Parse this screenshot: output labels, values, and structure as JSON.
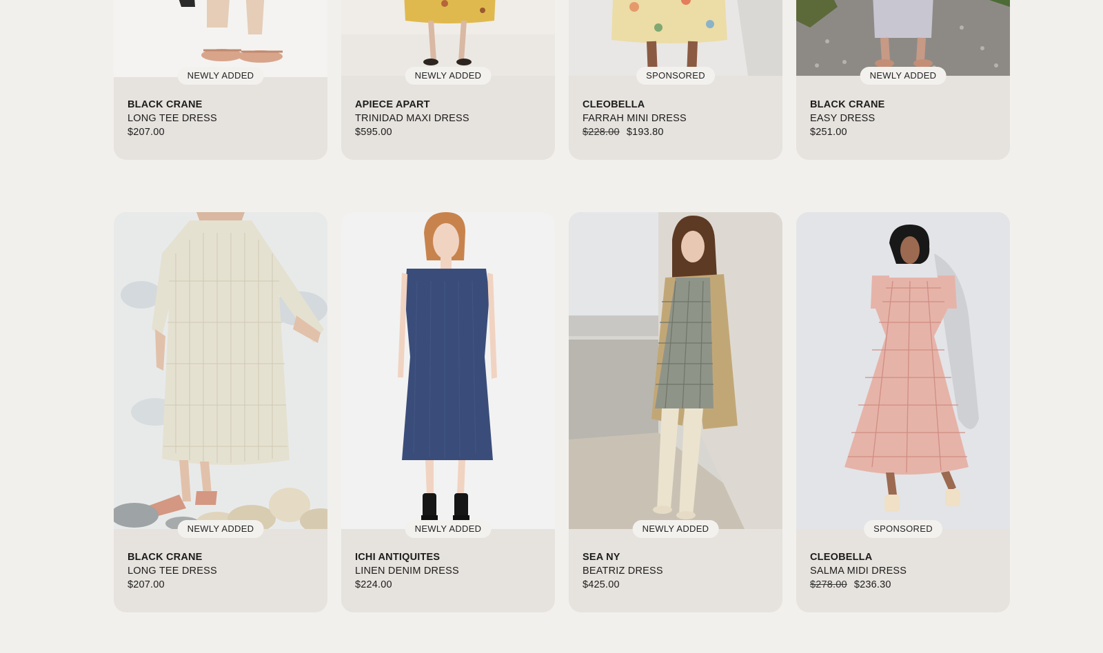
{
  "products": [
    {
      "badge": "NEWLY ADDED",
      "brand": "BLACK CRANE",
      "name": "LONG TEE DRESS",
      "price": "$207.00",
      "image": "model-woven-sandals-photo"
    },
    {
      "badge": "NEWLY ADDED",
      "brand": "APIECE APART",
      "name": "TRINIDAD MAXI DRESS",
      "price": "$595.00",
      "image": "model-yellow-floral-dress-photo"
    },
    {
      "badge": "SPONSORED",
      "brand": "CLEOBELLA",
      "name": "FARRAH MINI DRESS",
      "original_price": "$228.00",
      "sale_price": "$193.80",
      "image": "model-floral-mini-dress-photo"
    },
    {
      "badge": "NEWLY ADDED",
      "brand": "BLACK CRANE",
      "name": "EASY DRESS",
      "price": "$251.00",
      "image": "model-gravel-garden-photo"
    },
    {
      "badge": "NEWLY ADDED",
      "brand": "BLACK CRANE",
      "name": "LONG TEE DRESS",
      "price": "$207.00",
      "image": "model-cream-knit-dress-photo"
    },
    {
      "badge": "NEWLY ADDED",
      "brand": "ICHI ANTIQUITES",
      "name": "LINEN DENIM DRESS",
      "price": "$224.00",
      "image": "model-navy-linen-dress-photo"
    },
    {
      "badge": "NEWLY ADDED",
      "brand": "SEA NY",
      "name": "BEATRIZ DRESS",
      "price": "$425.00",
      "image": "model-plaid-dress-balcony-photo"
    },
    {
      "badge": "SPONSORED",
      "brand": "CLEOBELLA",
      "name": "SALMA MIDI DRESS",
      "original_price": "$278.00",
      "sale_price": "$236.30",
      "image": "model-pink-gingham-dress-photo"
    }
  ],
  "colors": {
    "page_background": "#f1f0ec",
    "card_background": "#e6e2dd",
    "badge_background": "#f3f1ee",
    "text": "#1c1c1c"
  }
}
